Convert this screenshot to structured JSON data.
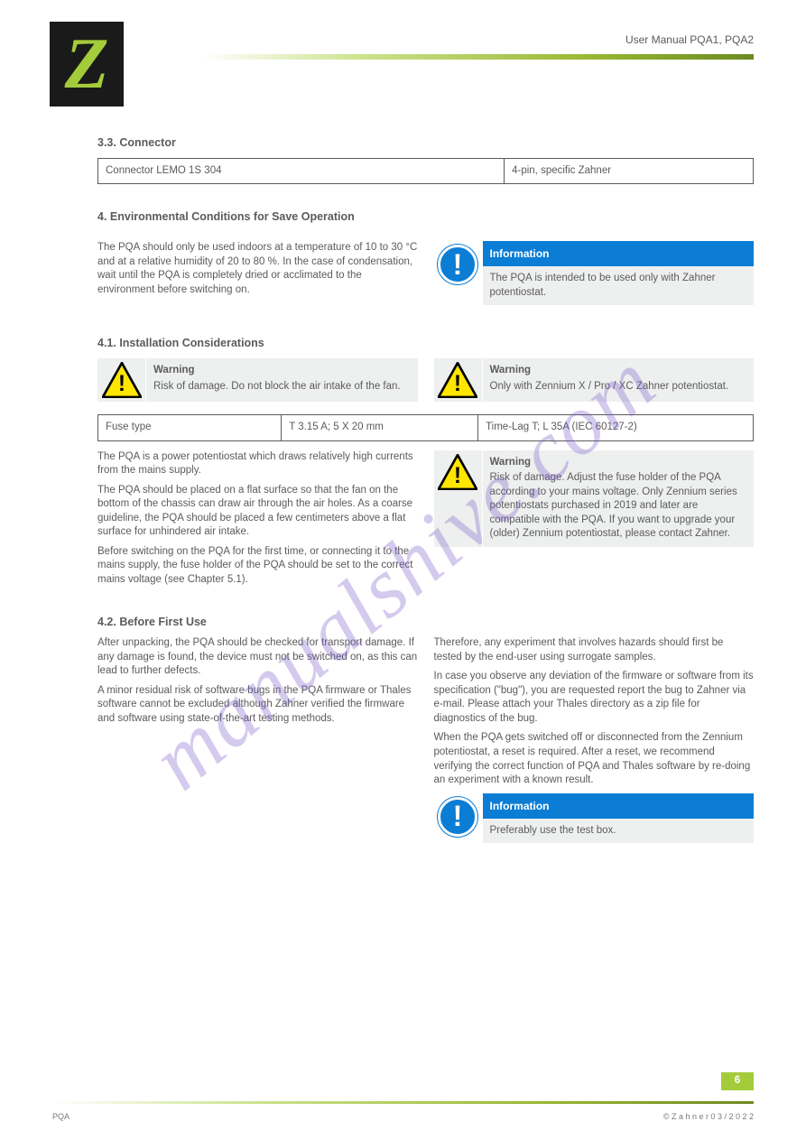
{
  "watermark": "manualshive.com",
  "logo_letter": "Z",
  "header_title": "User Manual PQA1, PQA2",
  "section_3_3": {
    "title": "3.3. Connector",
    "table": {
      "c1": "Connector LEMO 1S 304",
      "c2": "4-pin, specific Zahner"
    }
  },
  "section_4": {
    "title": "4. Environmental Conditions for Save Operation",
    "leftcol": {
      "para1": "The PQA should only be used indoors at a temperature of 10 to 30 °C and at a relative humidity of 20 to 80 %. In the case of condensation, wait until the PQA is completely dried or acclimated to the environment before switching on."
    },
    "info1": {
      "head": "Information",
      "body": "The PQA is intended to be used only with Zahner potentiostat."
    },
    "section_4_1": {
      "title": "4.1. Installation Considerations",
      "warn1": {
        "head": "Warning",
        "body": "Risk of damage. Do not block the air intake of the fan."
      },
      "warn2": {
        "head": "Warning",
        "body": "Only with Zennium X / Pro / XC Zahner potentiostat."
      },
      "table": {
        "c1": "Fuse type",
        "c2": "T 3.15 A; 5 X 20 mm",
        "c3": "Time-Lag T; L 35A (IEC 60127-2)"
      },
      "leftp": [
        "The PQA is a power potentiostat which draws relatively high currents from the mains supply.",
        "The PQA should be placed on a flat surface so that the fan on the bottom of the chassis can draw air through the air holes. As a coarse guideline, the PQA should be placed a few centimeters above a flat surface for unhindered air intake.",
        "Before switching on the PQA for the first time, or connecting it to the mains supply, the fuse holder of the PQA should be set to the correct mains voltage (see Chapter 5.1)."
      ],
      "warn3": {
        "head": "Warning",
        "body": "Risk of damage. Adjust the fuse holder of the PQA according to your mains voltage. Only Zennium series potentiostats purchased in 2019 and later are compatible with the PQA. If you want to upgrade your (older) Zennium potentiostat, please contact Zahner."
      }
    },
    "section_4_2": {
      "title": "4.2. Before First Use",
      "leftp": [
        "After unpacking, the PQA should be checked for transport damage. If any damage is found, the device must not be switched on, as this can lead to further defects.",
        "A minor residual risk of software bugs in the PQA firmware or Thales software cannot be excluded although Zahner verified the firmware and software using state-of-the-art testing methods."
      ],
      "rightp": [
        "Therefore, any experiment that involves hazards should first be tested by the end-user using surrogate samples.",
        "In case you observe any deviation of the firmware or software from its specification (\"bug\"), you are requested report the bug to Zahner via e-mail. Please attach your Thales directory as a zip file for diagnostics of the bug.",
        "When the PQA gets switched off or disconnected from the Zennium potentiostat, a reset is required. After a reset, we recommend verifying the correct function of PQA and Thales software by re-doing an experiment with a known result."
      ],
      "info2": {
        "head": "Information",
        "body": "Preferably use the test box."
      }
    }
  },
  "footer": {
    "page": "6",
    "left": "PQA",
    "right": "©  Z a h n e r  0 3 / 2 0 2 2"
  }
}
